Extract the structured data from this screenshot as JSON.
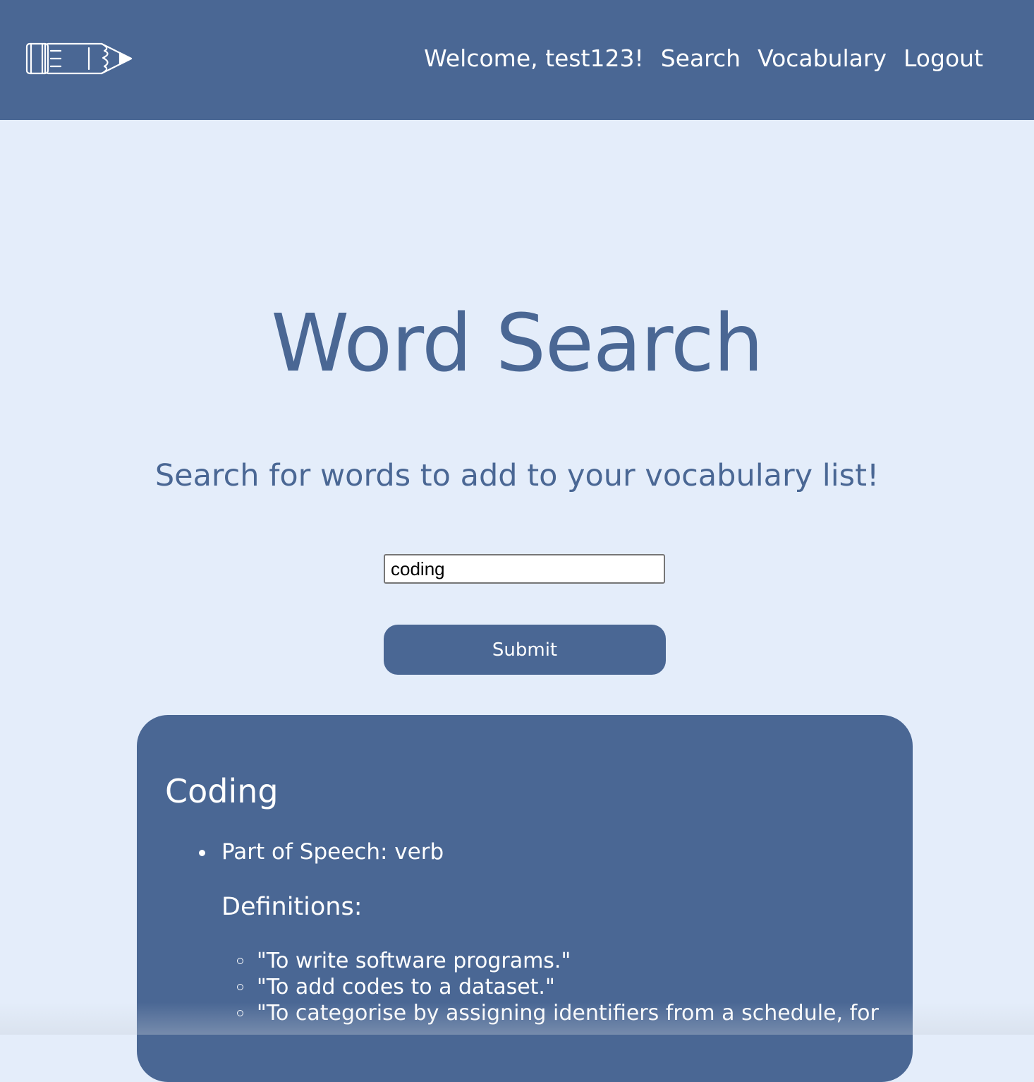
{
  "nav": {
    "logo_icon": "pencil-icon",
    "welcome": "Welcome, test123!",
    "links": [
      "Search",
      "Vocabulary",
      "Logout"
    ]
  },
  "main": {
    "title": "Word Search",
    "subtitle": "Search for words to add to your vocabulary list!",
    "search_value": "coding",
    "submit_label": "Submit"
  },
  "result": {
    "word": "Coding",
    "part_of_speech": "Part of Speech: verb",
    "definitions_heading": "Definitions:",
    "definitions": [
      "\"To write software programs.\"",
      "\"To add codes to a dataset.\"",
      "\"To categorise by assigning identifiers from a schedule, for"
    ]
  },
  "colors": {
    "primary": "#4a6794",
    "background": "#e4edfa",
    "text_light": "#ffffff"
  }
}
